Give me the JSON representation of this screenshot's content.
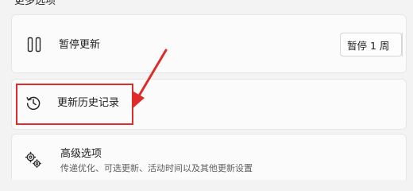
{
  "section": {
    "title": "更多选项"
  },
  "pause_updates": {
    "label": "暂停更新",
    "icon": "pause-icon",
    "dropdown_value": "暂停 1 周"
  },
  "update_history": {
    "label": "更新历史记录",
    "icon": "history-icon"
  },
  "advanced_options": {
    "label": "高级选项",
    "description": "传递优化、可选更新、活动时间以及其他更新设置",
    "icon": "gears-icon"
  },
  "annotation": {
    "highlight_color": "#e02b2b"
  }
}
